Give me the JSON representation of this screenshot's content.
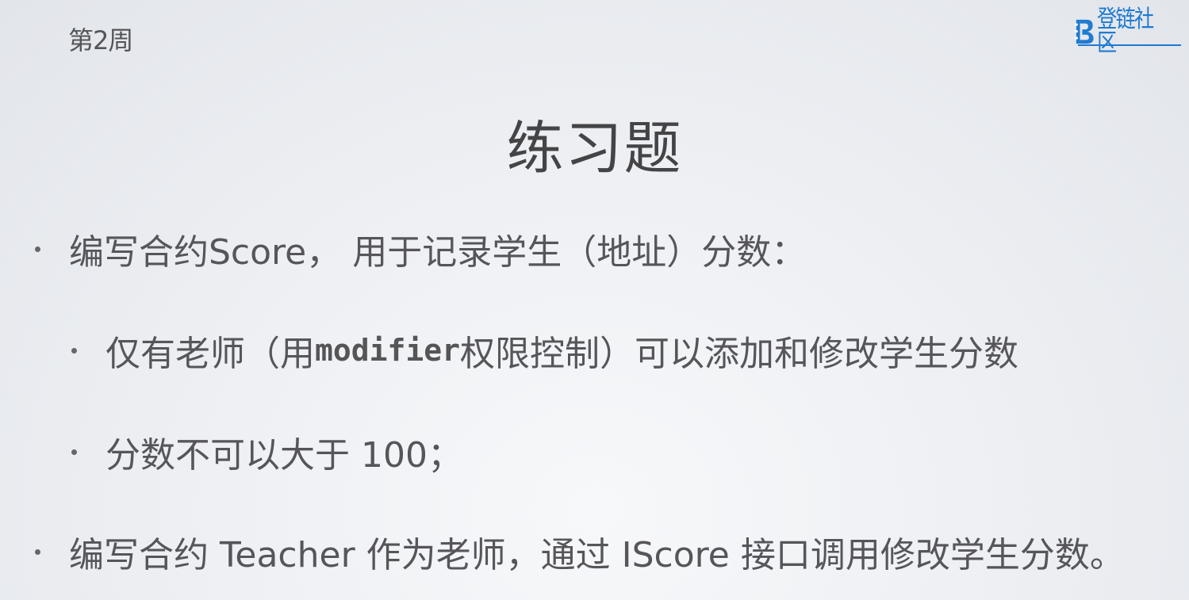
{
  "header": {
    "week_label": "第2周"
  },
  "logo": {
    "text": "登链社区",
    "color": "#1f7bd0",
    "icon": "blockchain-b-icon"
  },
  "slide": {
    "title": "练习题",
    "bullets": [
      {
        "level": 1,
        "text": "编写合约Score， 用于记录学生（地址）分数："
      },
      {
        "level": 2,
        "prefix": "仅有老师（用",
        "code": "modifier",
        "suffix": "权限控制）可以添加和修改学生分数"
      },
      {
        "level": 2,
        "text": "分数不可以大于 100；"
      },
      {
        "level": 1,
        "text": "编写合约 Teacher 作为老师，通过 IScore 接口调用修改学生分数。"
      }
    ]
  }
}
